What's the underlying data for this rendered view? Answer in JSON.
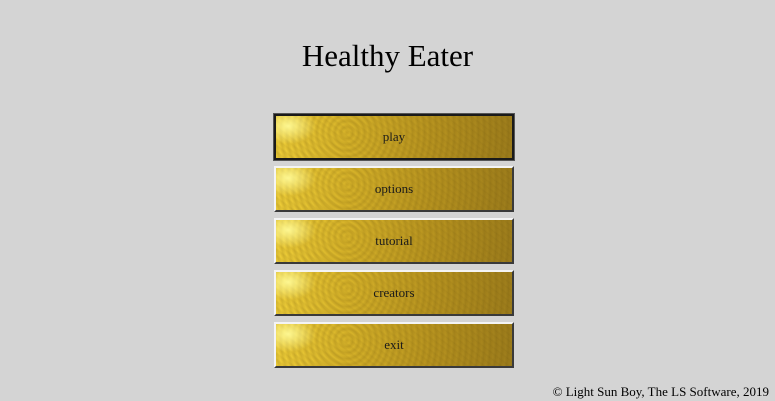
{
  "app": {
    "title": "Healthy Eater"
  },
  "menu": {
    "items": [
      {
        "label": "play"
      },
      {
        "label": "options"
      },
      {
        "label": "tutorial"
      },
      {
        "label": "creators"
      },
      {
        "label": "exit"
      }
    ],
    "selected": "play"
  },
  "footer": {
    "copyright": "© Light Sun Boy, The LS Software, 2019"
  },
  "colors": {
    "background": "#d4d4d4",
    "button_gold": "#d9b52a"
  }
}
